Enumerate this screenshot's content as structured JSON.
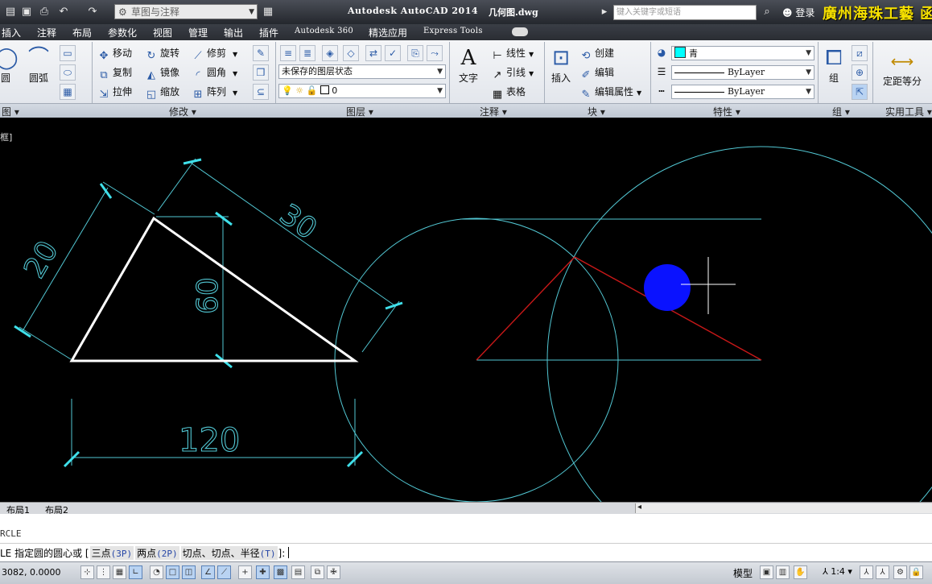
{
  "title_bar": {
    "workspace": "草图与注释",
    "app_title": "Autodesk AutoCAD 2014",
    "document": "几何图.dwg",
    "search_placeholder": "键入关键字或短语",
    "login": "登录",
    "watermark": "廣州海珠工藝 函"
  },
  "tabs": [
    "插入",
    "注释",
    "布局",
    "参数化",
    "视图",
    "管理",
    "输出",
    "插件",
    "Autodesk 360",
    "精选应用",
    "Express Tools"
  ],
  "ribbon": {
    "draw": {
      "circle": "圆",
      "arc": "圆弧",
      "label": "图"
    },
    "modify": {
      "items": [
        "移动",
        "旋转",
        "修剪",
        "复制",
        "镜像",
        "圆角",
        "拉伸",
        "缩放",
        "阵列"
      ],
      "label": "修改"
    },
    "layers": {
      "state": "未保存的图层状态",
      "current_layer": "0",
      "label": "图层"
    },
    "annotation": {
      "text": "文字",
      "linear": "线性",
      "leader": "引线",
      "table": "表格",
      "label": "注释"
    },
    "block": {
      "insert": "插入",
      "create": "创建",
      "edit": "编辑",
      "edit_attr": "编辑属性",
      "label": "块"
    },
    "properties": {
      "color": "青",
      "color_hex": "#00ffff",
      "linetype": "ByLayer",
      "lineweight": "ByLayer",
      "label": "特性"
    },
    "groups": {
      "group": "组",
      "label": "组"
    },
    "utilities": {
      "measure": "定距等分",
      "label": "实用工具"
    }
  },
  "drawing": {
    "viewport_label": "框]",
    "dim_20": "20",
    "dim_30": "30",
    "dim_60": "60",
    "dim_120": "120"
  },
  "layout_tabs": [
    "布局1",
    "布局2"
  ],
  "command": {
    "history": "RCLE",
    "prompt_prefix": "LE 指定圆的圆心或 [",
    "options": [
      {
        "label": "三点",
        "key": "(3P)"
      },
      {
        "label": "两点",
        "key": "(2P)"
      },
      {
        "label": "切点、切点、半径",
        "key": "(T)"
      }
    ],
    "prompt_suffix": "]:"
  },
  "status": {
    "coords": "3082, 0.0000",
    "model": "模型",
    "scale": "1:4"
  }
}
